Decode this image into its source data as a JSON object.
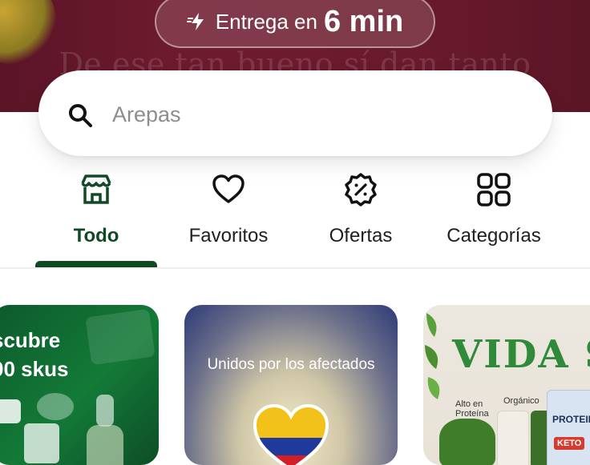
{
  "hero": {
    "tagline": "De ese tan bueno sí dan tanto",
    "delivery_prefix": "Entrega en",
    "delivery_time": "6 min"
  },
  "search": {
    "placeholder": "Arepas",
    "value": ""
  },
  "tabs": [
    {
      "label": "Todo",
      "icon": "store-icon",
      "active": true
    },
    {
      "label": "Favoritos",
      "icon": "heart-icon",
      "active": false
    },
    {
      "label": "Ofertas",
      "icon": "discount-badge-icon",
      "active": false
    },
    {
      "label": "Categorías",
      "icon": "grid-icon",
      "active": false
    }
  ],
  "cards": [
    {
      "lines": [
        "scubre",
        "00 skus"
      ]
    },
    {
      "title": "Unidos por los afectados"
    },
    {
      "brand": "VIDA SAN",
      "tags": [
        "Alto en Proteína",
        "Orgánico",
        "PROTEIN",
        "KETO"
      ]
    }
  ],
  "colors": {
    "accent": "#0f4a24",
    "hero": "#6a1a2d"
  }
}
